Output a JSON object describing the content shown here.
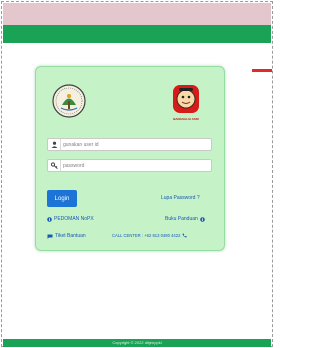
{
  "colors": {
    "header_band": "#e4c7cd",
    "header_green": "#1aa356",
    "card_bg": "#c6f2c8",
    "primary": "#1c75d6",
    "accent_red": "#e12b2b"
  },
  "footer": {
    "text": "Copyright © 2022 ditjenppkl"
  },
  "login": {
    "logo_left": "kementerian-lhk-logo",
    "logo_right": {
      "icon": "mascot-logo",
      "caption": "BANGSALIA ASRI"
    },
    "user_field": {
      "icon": "user-icon",
      "placeholder": "gunakan user id"
    },
    "password_field": {
      "icon": "key-icon",
      "placeholder": "password"
    },
    "login_button": "Login",
    "forgot_password": "Lupa Password ?",
    "pedoman_link": "PEDOMAN NoPX",
    "buku_panduan_link": "Buku Panduan",
    "tiket_bantuan_link": "Tiket Bantuan",
    "call_center": "CALL CENTER : +62 813 0480 4422"
  }
}
